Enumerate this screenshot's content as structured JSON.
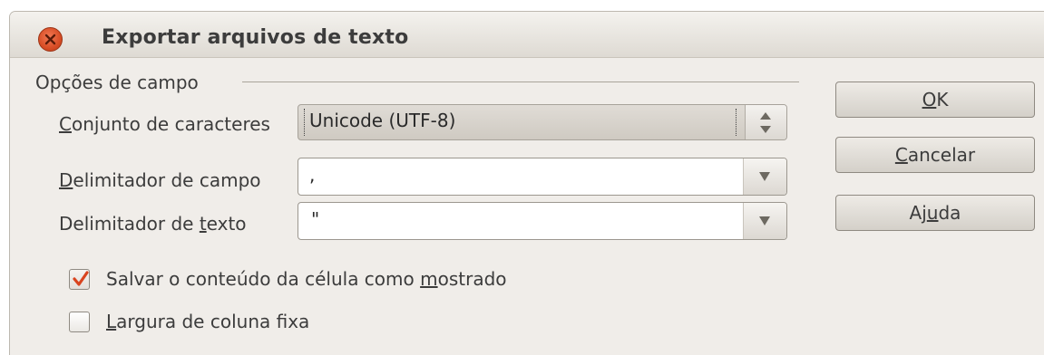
{
  "window": {
    "title": "Exportar arquivos de texto"
  },
  "field_options": {
    "section_title": "Opções de campo",
    "charset": {
      "label_u": "C",
      "label_rest": "onjunto de caracteres",
      "value": "Unicode (UTF-8)"
    },
    "field_delimiter": {
      "label_u": "D",
      "label_rest": "elimitador de campo",
      "value": ","
    },
    "text_delimiter": {
      "label_pre": "Delimitador de ",
      "label_u": "t",
      "label_rest": "exto",
      "value": "\""
    }
  },
  "options": {
    "save_as_shown": {
      "label_pre": "Salvar o conteúdo da célula como ",
      "label_u": "m",
      "label_rest": "ostrado",
      "checked": true
    },
    "fixed_width": {
      "label_u": "L",
      "label_rest": "argura de coluna fixa",
      "checked": false
    }
  },
  "buttons": {
    "ok": {
      "u": "O",
      "rest": "K"
    },
    "cancel": {
      "u": "C",
      "rest": "ancelar"
    },
    "help": {
      "pre": "Aj",
      "u": "u",
      "rest": "da"
    }
  },
  "colors": {
    "close_button": "#d84d25",
    "checkmark": "#d9441f"
  }
}
